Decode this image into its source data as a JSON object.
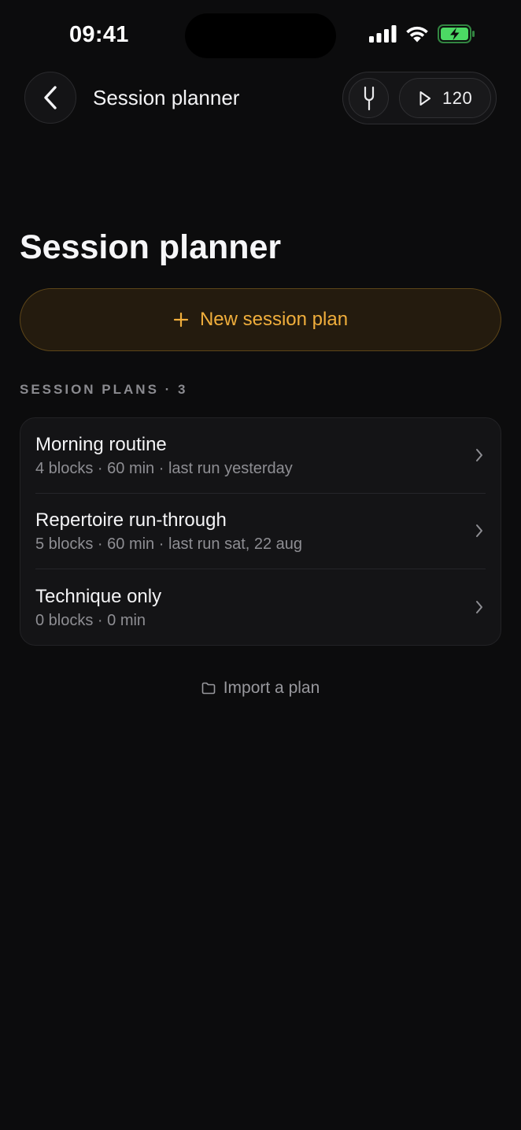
{
  "status_bar": {
    "time": "09:41",
    "icons": [
      "cellular-signal-icon",
      "wifi-icon",
      "battery-charging-icon"
    ]
  },
  "nav": {
    "back_icon": "chevron-left-icon",
    "title": "Session planner",
    "tuner_icon": "tuning-fork-icon",
    "tempo_icon": "play-icon",
    "tempo_value": "120"
  },
  "page": {
    "title": "Session planner",
    "new_plan_label": "New session plan",
    "new_plan_icon": "plus-icon",
    "section_label": "SESSION PLANS · 3",
    "import_label": "Import a plan",
    "import_icon": "folder-icon"
  },
  "plans": [
    {
      "name": "Morning routine",
      "meta": "4 blocks · 60 min · last run yesterday"
    },
    {
      "name": "Repertoire run-through",
      "meta": "5 blocks · 60 min · last run sat, 22 aug"
    },
    {
      "name": "Technique only",
      "meta": "0 blocks · 0 min"
    }
  ],
  "colors": {
    "background": "#0c0c0d",
    "accent": "#f0ae3c",
    "battery": "#4cd964"
  }
}
